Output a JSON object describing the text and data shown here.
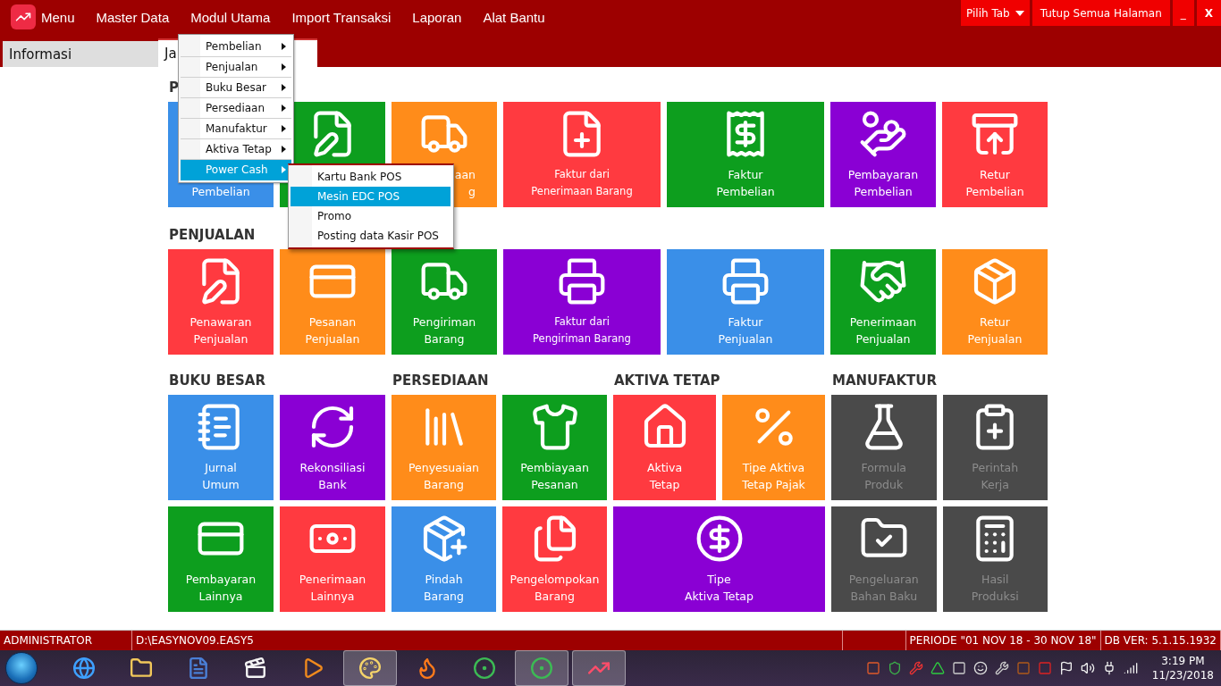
{
  "menubar": {
    "items": [
      "Menu",
      "Master Data",
      "Modul Utama",
      "Import Transaksi",
      "Laporan",
      "Alat Bantu"
    ],
    "right_buttons": [
      {
        "label": "Pilih Tab",
        "kind": "dropdown"
      },
      {
        "label": "Tutup Semua Halaman",
        "kind": "plain"
      },
      {
        "label": "_",
        "kind": "plain"
      },
      {
        "label": "X",
        "kind": "close"
      }
    ]
  },
  "tabs": [
    {
      "label": "Informasi",
      "selected": false
    },
    {
      "label": "Ja",
      "selected": true
    }
  ],
  "dropdown": {
    "items": [
      {
        "label": "Pembelian",
        "selected": false
      },
      {
        "label": "Penjualan",
        "selected": false
      },
      {
        "label": "Buku Besar",
        "selected": false
      },
      {
        "label": "Persediaan",
        "selected": false
      },
      {
        "label": "Manufaktur",
        "selected": false
      },
      {
        "label": "Aktiva Tetap",
        "selected": false
      },
      {
        "label": "Power Cash",
        "selected": true
      }
    ],
    "submenu": [
      {
        "label": "Kartu Bank POS",
        "selected": false
      },
      {
        "label": "Mesin EDC POS",
        "selected": true
      },
      {
        "label": "Promo",
        "selected": false
      },
      {
        "label": "Posting data Kasir POS",
        "selected": false
      }
    ]
  },
  "upper_sections": [
    {
      "heading": "P",
      "tiles": [
        {
          "lines": [
            "Pembelian"
          ],
          "color": "#3a8fe8",
          "disabled": false
        },
        {
          "color": "#0d9e1e"
        },
        {
          "lines": [
            "aan",
            "g"
          ],
          "color": "#ff8c1a",
          "disabled": false,
          "clipped": true
        },
        {
          "lines": [
            "Faktur dari",
            "Penerimaan Barang"
          ],
          "color": "#ff3a40",
          "disabled": false
        },
        {
          "lines": [
            "Faktur",
            "Pembelian"
          ],
          "color": "#0d9e1e",
          "disabled": false
        },
        {
          "lines": [
            "Pembayaran",
            "Pembelian"
          ],
          "color": "#8a00d4",
          "disabled": false
        },
        {
          "lines": [
            "Retur",
            "Pembelian"
          ],
          "color": "#ff3a40",
          "disabled": false
        }
      ]
    },
    {
      "heading": "PENJUALAN",
      "tiles": [
        {
          "lines": [
            "Penawaran",
            "Penjualan"
          ],
          "color": "#ff3a40",
          "disabled": false
        },
        {
          "lines": [
            "Pesanan",
            "Penjualan"
          ],
          "color": "#ff8c1a",
          "disabled": false
        },
        {
          "lines": [
            "Pengiriman",
            "Barang"
          ],
          "color": "#0d9e1e",
          "disabled": false
        },
        {
          "lines": [
            "Faktur dari",
            "Pengiriman Barang"
          ],
          "color": "#8a00d4",
          "disabled": false
        },
        {
          "lines": [
            "Faktur",
            "Penjualan"
          ],
          "color": "#3a8fe8",
          "disabled": false
        },
        {
          "lines": [
            "Penerimaan",
            "Penjualan"
          ],
          "color": "#0d9e1e",
          "disabled": false
        },
        {
          "lines": [
            "Retur",
            "Penjualan"
          ],
          "color": "#ff8c1a",
          "disabled": false
        }
      ]
    }
  ],
  "lower_sections": [
    {
      "heading": "BUKU BESAR",
      "tiles": [
        {
          "lines": [
            "Jurnal",
            "Umum"
          ],
          "color": "#3a8fe8",
          "disabled": false
        },
        {
          "lines": [
            "Rekonsiliasi",
            "Bank"
          ],
          "color": "#8a00d4",
          "disabled": false
        },
        {
          "lines": [
            "Pembayaran",
            "Lainnya"
          ],
          "color": "#0d9e1e",
          "disabled": false
        },
        {
          "lines": [
            "Penerimaan",
            "Lainnya"
          ],
          "color": "#ff3a40",
          "disabled": false
        }
      ]
    },
    {
      "heading": "PERSEDIAAN",
      "tiles": [
        {
          "lines": [
            "Penyesuaian",
            "Barang"
          ],
          "color": "#ff8c1a",
          "disabled": false
        },
        {
          "lines": [
            "Pembiayaan",
            "Pesanan"
          ],
          "color": "#0d9e1e",
          "disabled": false
        },
        {
          "lines": [
            "Pindah",
            "Barang"
          ],
          "color": "#3a8fe8",
          "disabled": false
        },
        {
          "lines": [
            "Pengelompokan",
            "Barang"
          ],
          "color": "#ff3a40",
          "disabled": false
        }
      ]
    },
    {
      "heading": "AKTIVA TETAP",
      "tiles": [
        {
          "lines": [
            "Aktiva",
            "Tetap"
          ],
          "color": "#ff3a40",
          "disabled": false
        },
        {
          "lines": [
            "Tipe Aktiva",
            "Tetap Pajak"
          ],
          "color": "#ff8c1a",
          "disabled": false
        },
        {
          "lines": [
            "Tipe",
            "Aktiva Tetap"
          ],
          "color": "#8a00d4",
          "disabled": false,
          "wide": true
        }
      ]
    },
    {
      "heading": "MANUFAKTUR",
      "tiles": [
        {
          "lines": [
            "Formula",
            "Produk"
          ],
          "color": "#4a4a4a",
          "disabled": true
        },
        {
          "lines": [
            "Perintah",
            "Kerja"
          ],
          "color": "#4a4a4a",
          "disabled": true
        },
        {
          "lines": [
            "Pengeluaran",
            "Bahan Baku"
          ],
          "color": "#4a4a4a",
          "disabled": true
        },
        {
          "lines": [
            "Hasil",
            "Produksi"
          ],
          "color": "#4a4a4a",
          "disabled": true
        }
      ]
    }
  ],
  "status_bar": [
    "ADMINISTRATOR",
    "D:\\EASYNOV09.EASY5",
    "PERIODE \"01 NOV 18 - 30 NOV 18\"",
    "DB VER: 5.1.15.1932"
  ],
  "taskbar": {
    "apps": [
      {
        "selected": false
      },
      {
        "selected": false
      },
      {
        "selected": false
      },
      {
        "selected": false
      },
      {
        "selected": false
      },
      {
        "selected": true
      },
      {
        "selected": false
      },
      {
        "selected": false
      },
      {
        "selected": true
      },
      {
        "selected": true
      }
    ],
    "time": "3:19 PM",
    "date": "11/23/2018"
  }
}
